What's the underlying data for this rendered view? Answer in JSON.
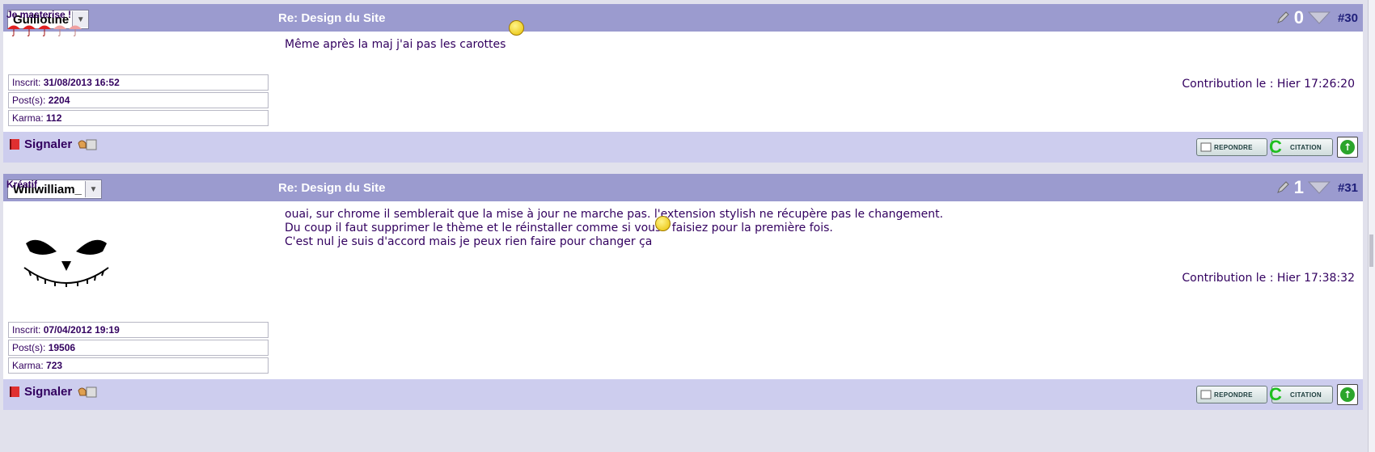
{
  "posts": [
    {
      "author": "Guillotine",
      "title": "Re: Design du Site",
      "votes": "0",
      "number": "#30",
      "rank": "Je masterise !",
      "registered_label": "Inscrit:",
      "registered": "31/08/2013 16:52",
      "posts_label": "Post(s):",
      "posts": "2204",
      "karma_label": "Karma:",
      "karma": "112",
      "lines": [
        "Même après la maj j'ai pas les carottes"
      ],
      "contribution": "Contribution le : Hier 17:26:20",
      "report": "Signaler"
    },
    {
      "author": "Wiliwilliam_",
      "title": "Re: Design du Site",
      "votes": "1",
      "number": "#31",
      "rank": "Kréatif",
      "registered_label": "Inscrit:",
      "registered": "07/04/2012 19:19",
      "posts_label": "Post(s):",
      "posts": "19506",
      "karma_label": "Karma:",
      "karma": "723",
      "lines": [
        "ouai, sur chrome il semblerait que la mise à jour ne marche pas. l'extension stylish ne récupère pas le changement.",
        "Du coup il faut supprimer le thème et le réinstaller comme si vous   faisiez pour la première fois.",
        "C'est nul je suis d'accord mais je peux rien faire pour changer ça"
      ],
      "contribution": "Contribution le : Hier 17:38:32",
      "report": "Signaler"
    }
  ],
  "buttons": {
    "reply": "REPONDRE",
    "quote": "CITATION",
    "quote_letter": "C",
    "up": "↑"
  },
  "colors": {
    "header": "#9b9bcf",
    "footer": "#cdcdee",
    "text": "#32005f",
    "background": "#e1e1ec"
  },
  "icons": [
    "pencil-icon",
    "downvote-arrow-icon",
    "flag-icon",
    "report-hand-icon",
    "umbrella-icon",
    "smiley-icon",
    "avatar-skull",
    "up-arrow-icon"
  ]
}
